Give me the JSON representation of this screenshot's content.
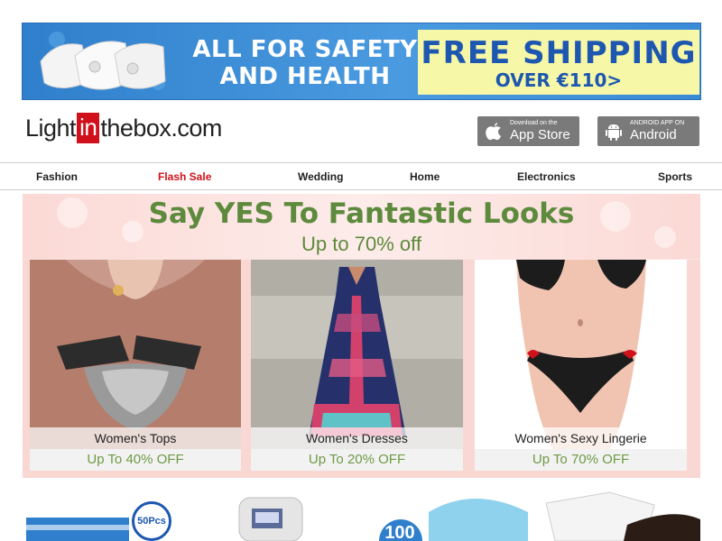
{
  "banner": {
    "headline": [
      "ALL FOR SAFETY",
      "AND HEALTH"
    ],
    "shipping_title": "FREE SHIPPING",
    "shipping_sub": "OVER €110>"
  },
  "logo": {
    "pre": "Light",
    "highlight": "in",
    "post": "thebox.com"
  },
  "app_buttons": {
    "apple": {
      "small": "Download on the",
      "big": "App Store",
      "icon": "apple-icon"
    },
    "android": {
      "small": "ANDROID APP ON",
      "big": "Android",
      "icon": "android-icon"
    }
  },
  "nav": {
    "items": [
      "Fashion",
      "Flash Sale",
      "Wedding",
      "Home",
      "Electronics",
      "Sports"
    ],
    "accent_color": "#d0111b"
  },
  "promo": {
    "title": "Say YES To Fantastic Looks",
    "subtitle": "Up to 70% off",
    "cards": [
      {
        "name": "Women's Tops",
        "offer": "Up To 40% OFF"
      },
      {
        "name": "Women's Dresses",
        "offer": "Up To 20% OFF"
      },
      {
        "name": "Women's Sexy Lingerie",
        "offer": "Up To 70% OFF"
      }
    ]
  },
  "bottom": {
    "badge_50": "50Pcs",
    "badge_100": "100"
  },
  "colors": {
    "banner_blue": "#3a8ad6",
    "shipping_yellow": "#f7f7a8",
    "promo_green": "#5d8a3c",
    "promo_pink": "#fbe4e1"
  }
}
